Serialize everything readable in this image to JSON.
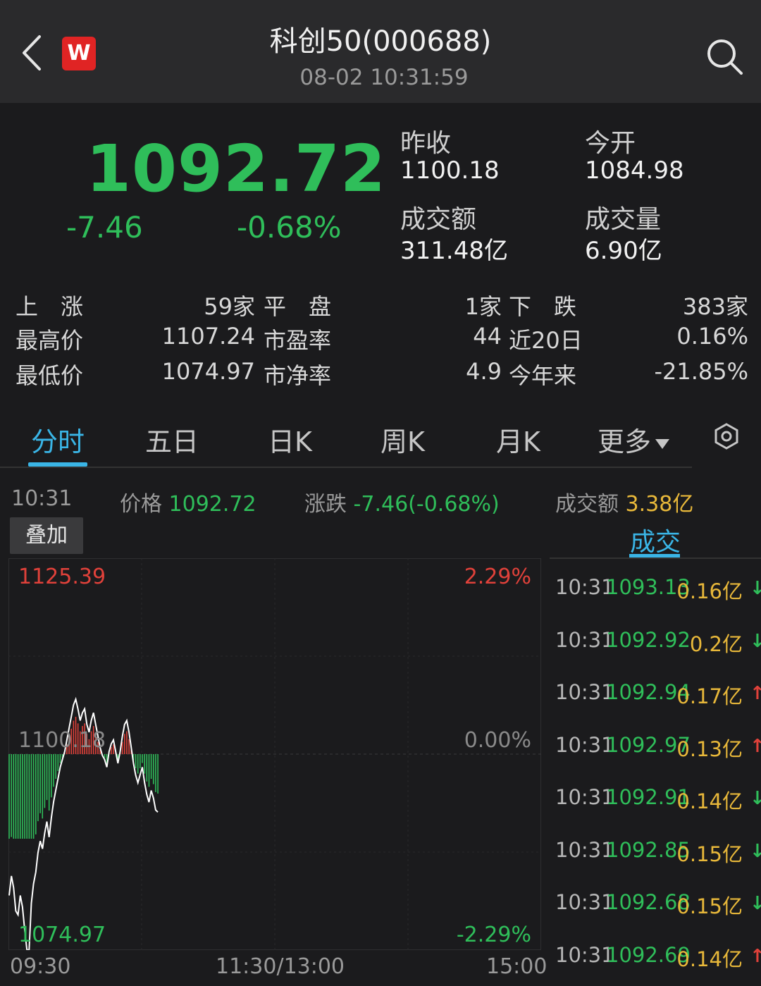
{
  "header": {
    "title": "科创50(000688)",
    "subtitle": "08-02 10:31:59",
    "logo_letter": "W",
    "back_icon": "chevron-left-icon",
    "search_icon": "search-icon"
  },
  "quote": {
    "price": "1092.72",
    "change": "-7.46",
    "change_pct": "-0.68%",
    "prev_close_label": "昨收",
    "prev_close": "1100.18",
    "open_label": "今开",
    "open": "1084.98",
    "turnover_label": "成交额",
    "turnover": "311.48亿",
    "volume_label": "成交量",
    "volume": "6.90亿"
  },
  "stats": {
    "rows": [
      [
        {
          "label": "上　涨",
          "value": "59家"
        },
        {
          "label": "平　盘",
          "value": "1家"
        },
        {
          "label": "下　跌",
          "value": "383家"
        }
      ],
      [
        {
          "label": "最高价",
          "value": "1107.24"
        },
        {
          "label": "市盈率",
          "value": "44"
        },
        {
          "label": "近20日",
          "value": "0.16%"
        }
      ],
      [
        {
          "label": "最低价",
          "value": "1074.97"
        },
        {
          "label": "市净率",
          "value": "4.9"
        },
        {
          "label": "今年来",
          "value": "-21.85%"
        }
      ]
    ]
  },
  "tabs": {
    "items": [
      "分时",
      "五日",
      "日K",
      "周K",
      "月K",
      "更多"
    ],
    "active": 0,
    "settings_icon": "settings-hexagon-icon"
  },
  "info": {
    "time": "10:31",
    "price_label": "价格",
    "price": "1092.72",
    "change_label": "涨跌",
    "change": "-7.46(-0.68%)",
    "turnover_label": "成交额",
    "turnover": "3.38亿",
    "overlay_button": "叠加"
  },
  "chart_data": {
    "type": "line",
    "session_start": "09:30",
    "session_mid": "11:30/13:00",
    "session_end": "15:00",
    "y_top_label": "1125.39",
    "y_mid_label": "1100.18",
    "y_bottom_label": "1074.97",
    "pct_top_label": "2.29%",
    "pct_mid_label": "0.00%",
    "pct_bottom_label": "-2.29%",
    "ylim": [
      1074.97,
      1125.39
    ],
    "base": 1100.18,
    "total_minutes": 240,
    "series": [
      {
        "values": [
          1082.0,
          1084.5,
          1083.0,
          1080.0,
          1079.5,
          1082.0,
          1080.5,
          1077.5,
          1075.0,
          1074.97,
          1081.0,
          1083.5,
          1085.0,
          1087.5,
          1089.0,
          1088.0,
          1090.0,
          1091.5,
          1089.5,
          1092.0,
          1094.0,
          1095.5,
          1097.0,
          1098.5,
          1099.5,
          1100.5,
          1102.0,
          1103.5,
          1105.0,
          1106.5,
          1107.24,
          1106.0,
          1104.5,
          1105.5,
          1106.0,
          1104.0,
          1103.0,
          1104.5,
          1105.5,
          1104.0,
          1102.5,
          1101.0,
          1100.0,
          1099.5,
          1098.5,
          1100.5,
          1101.5,
          1102.0,
          1100.5,
          1099.0,
          1100.5,
          1102.5,
          1104.0,
          1104.5,
          1103.0,
          1101.0,
          1099.0,
          1097.5,
          1096.5,
          1097.5,
          1098.5,
          1096.5,
          1095.0,
          1094.0,
          1095.5,
          1094.5,
          1093.0,
          1092.72
        ]
      }
    ],
    "bar_colors": {
      "up": "#e0413a",
      "down": "#2fbe5a"
    }
  },
  "trades": {
    "tab_label": "成交",
    "rows": [
      {
        "time": "10:31",
        "price": "1093.13",
        "amount": "0.16亿",
        "dir": "down"
      },
      {
        "time": "10:31",
        "price": "1092.92",
        "amount": "0.2亿",
        "dir": "down"
      },
      {
        "time": "10:31",
        "price": "1092.94",
        "amount": "0.17亿",
        "dir": "up"
      },
      {
        "time": "10:31",
        "price": "1092.97",
        "amount": "0.13亿",
        "dir": "up"
      },
      {
        "time": "10:31",
        "price": "1092.91",
        "amount": "0.14亿",
        "dir": "down"
      },
      {
        "time": "10:31",
        "price": "1092.85",
        "amount": "0.15亿",
        "dir": "down"
      },
      {
        "time": "10:31",
        "price": "1092.68",
        "amount": "0.15亿",
        "dir": "down"
      },
      {
        "time": "10:31",
        "price": "1092.69",
        "amount": "0.14亿",
        "dir": "up"
      }
    ]
  },
  "colors": {
    "up": "#e0413a",
    "down": "#2fbe5a",
    "accent": "#3ab5e6",
    "amount": "#e8b83a",
    "background": "#1b1b1d"
  }
}
